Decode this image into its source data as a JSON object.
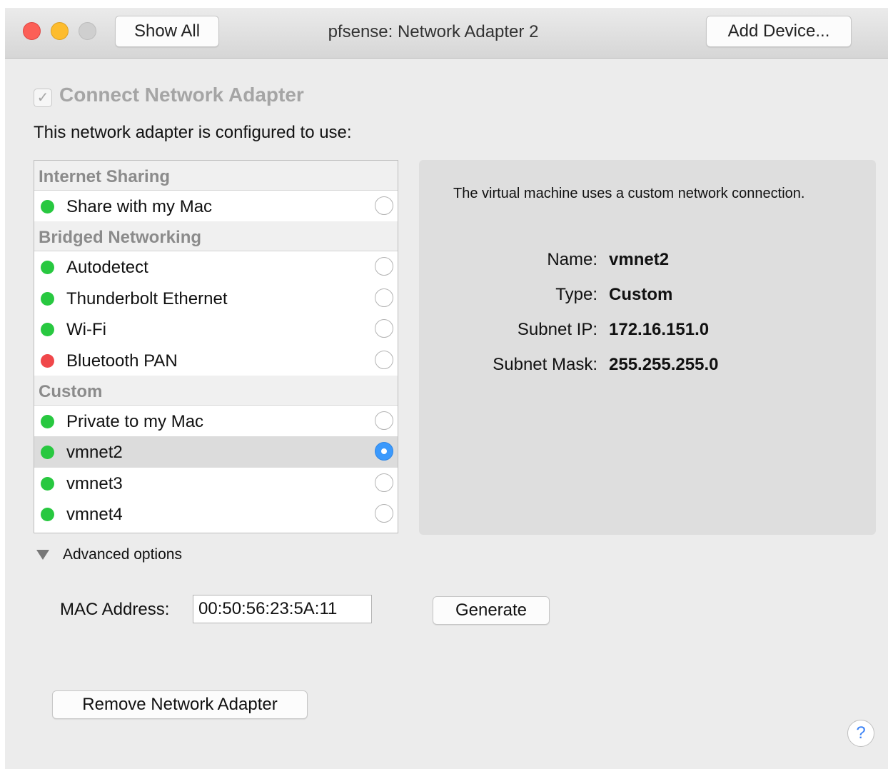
{
  "window": {
    "title": "pfsense: Network Adapter 2",
    "show_all_label": "Show All",
    "add_device_label": "Add Device..."
  },
  "connect": {
    "checked": true,
    "check_glyph": "✓",
    "label": "Connect Network Adapter"
  },
  "config_label": "This network adapter is configured to use:",
  "sections": [
    {
      "title": "Internet Sharing",
      "items": [
        {
          "label": "Share with my Mac",
          "status": "green",
          "selected": false
        }
      ]
    },
    {
      "title": "Bridged Networking",
      "items": [
        {
          "label": "Autodetect",
          "status": "green",
          "selected": false
        },
        {
          "label": "Thunderbolt Ethernet",
          "status": "green",
          "selected": false
        },
        {
          "label": "Wi-Fi",
          "status": "green",
          "selected": false
        },
        {
          "label": "Bluetooth PAN",
          "status": "red",
          "selected": false
        }
      ]
    },
    {
      "title": "Custom",
      "items": [
        {
          "label": "Private to my Mac",
          "status": "green",
          "selected": false
        },
        {
          "label": "vmnet2",
          "status": "green",
          "selected": true
        },
        {
          "label": "vmnet3",
          "status": "green",
          "selected": false
        },
        {
          "label": "vmnet4",
          "status": "green",
          "selected": false
        }
      ]
    }
  ],
  "info": {
    "description": "The virtual machine uses a custom network connection.",
    "fields": [
      {
        "key": "Name:",
        "value": "vmnet2"
      },
      {
        "key": "Type:",
        "value": "Custom"
      },
      {
        "key": "Subnet IP:",
        "value": "172.16.151.0"
      },
      {
        "key": "Subnet Mask:",
        "value": "255.255.255.0"
      }
    ]
  },
  "advanced": {
    "label": "Advanced options",
    "expanded": true,
    "mac_label": "MAC Address:",
    "mac_value": "00:50:56:23:5A:11",
    "generate_label": "Generate"
  },
  "remove_label": "Remove Network Adapter",
  "help_label": "?",
  "colors": {
    "status_green": "#28c840",
    "status_red": "#f0474a",
    "selected_row": "#dcdcdc",
    "radio_selected": "#3b99fc"
  },
  "icons": {
    "close": "window-close-icon",
    "minimize": "window-minimize-icon",
    "zoom": "window-zoom-icon",
    "disclosure": "disclosure-triangle-icon",
    "help": "help-icon"
  }
}
